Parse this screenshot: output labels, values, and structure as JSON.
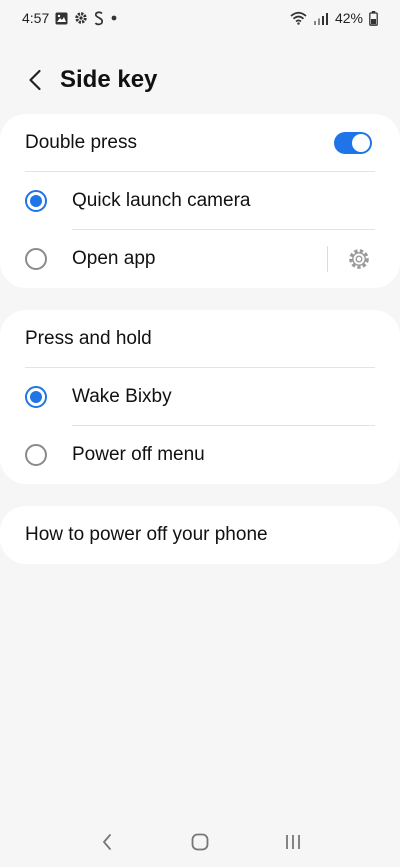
{
  "status_bar": {
    "time": "4:57",
    "battery": "42%",
    "icons_left": [
      "gallery-icon",
      "settings-icon",
      "s-icon",
      "dot-icon"
    ],
    "icons_right": [
      "wifi-icon",
      "signal-icon",
      "battery-icon"
    ]
  },
  "header": {
    "title": "Side key",
    "back_icon": "back-arrow-icon"
  },
  "double_press": {
    "label": "Double press",
    "toggle_on": true,
    "options": [
      {
        "label": "Quick launch camera",
        "selected": true
      },
      {
        "label": "Open app",
        "selected": false,
        "has_settings": true
      }
    ]
  },
  "press_and_hold": {
    "label": "Press and hold",
    "options": [
      {
        "label": "Wake Bixby",
        "selected": true
      },
      {
        "label": "Power off menu",
        "selected": false
      }
    ]
  },
  "help": {
    "label": "How to power off your phone"
  },
  "navbar": {
    "icons": [
      "back-icon",
      "home-icon",
      "recents-icon"
    ]
  },
  "colors": {
    "accent": "#1f75e8",
    "background": "#f6f6f6",
    "card": "#ffffff"
  }
}
